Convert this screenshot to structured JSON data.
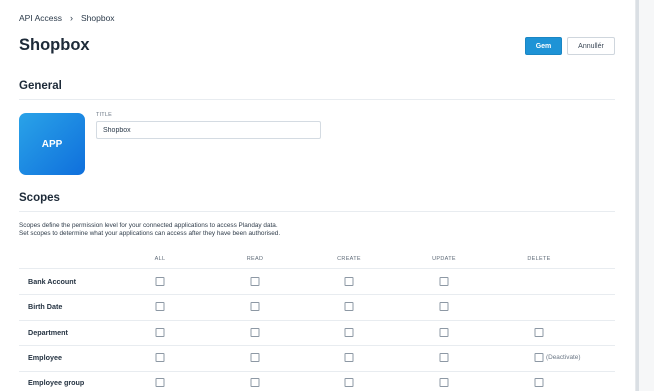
{
  "breadcrumb": {
    "parent": "API Access",
    "current": "Shopbox"
  },
  "page": {
    "title": "Shopbox"
  },
  "actions": {
    "save_label": "Gem",
    "cancel_label": "Annullér"
  },
  "general": {
    "heading": "General",
    "app_icon_text": "APP",
    "title_label": "TITLE",
    "title_value": "Shopbox"
  },
  "scopes": {
    "heading": "Scopes",
    "description_line1": "Scopes define the permission level for your connected applications to access Planday data.",
    "description_line2": "Set scopes to determine what your applications can access after they have been authorised.",
    "columns": [
      "ALL",
      "READ",
      "CREATE",
      "UPDATE",
      "DELETE"
    ],
    "rows": [
      {
        "label": "Bank Account",
        "checks": [
          false,
          false,
          false,
          false,
          null
        ]
      },
      {
        "label": "Birth Date",
        "checks": [
          false,
          false,
          false,
          false,
          null
        ]
      },
      {
        "label": "Department",
        "checks": [
          false,
          false,
          false,
          false,
          false
        ]
      },
      {
        "label": "Employee",
        "checks": [
          false,
          false,
          false,
          false,
          false
        ],
        "note": "(Deactivate)"
      },
      {
        "label": "Employee group",
        "checks": [
          false,
          false,
          false,
          false,
          false
        ]
      }
    ]
  },
  "colors": {
    "accent": "#1e93d6",
    "app_gradient_start": "#2aa3e8",
    "app_gradient_end": "#0f6fdc"
  }
}
